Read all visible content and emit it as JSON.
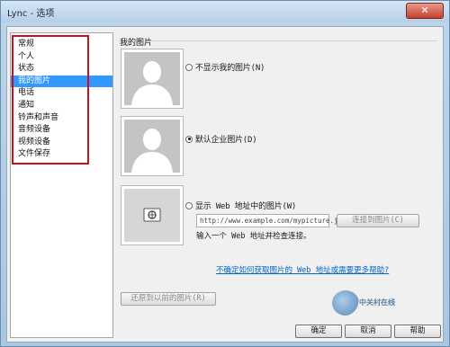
{
  "window": {
    "title": "Lync - 选项",
    "close_glyph": "✕"
  },
  "nav": {
    "items": [
      {
        "label": "常规",
        "selected": false
      },
      {
        "label": "个人",
        "selected": false
      },
      {
        "label": "状态",
        "selected": false
      },
      {
        "label": "我的图片",
        "selected": true
      },
      {
        "label": "电话",
        "selected": false
      },
      {
        "label": "通知",
        "selected": false
      },
      {
        "label": "铃声和声音",
        "selected": false
      },
      {
        "label": "音频设备",
        "selected": false
      },
      {
        "label": "视频设备",
        "selected": false
      },
      {
        "label": "文件保存",
        "selected": false
      }
    ],
    "highlight_color": "#c8101c"
  },
  "section": {
    "title": "我的图片"
  },
  "options": {
    "hide": {
      "label": "不显示我的图片(N)",
      "checked": false
    },
    "default": {
      "label": "默认企业图片(D)",
      "checked": true
    },
    "web": {
      "label": "显示 Web 地址中的图片(W)",
      "checked": false
    }
  },
  "url": {
    "placeholder": "http://www.example.com/mypicture.jpg",
    "connect_label": "连接到图片(C)",
    "hint": "输入一个 Web 地址并检查连接。"
  },
  "help_link": "不确定如何获取图片的 Web 地址或需要更多帮助?",
  "restore_label": "还原到以前的图片(R)",
  "footer": {
    "ok": "确定",
    "cancel": "取消",
    "help": "帮助"
  },
  "watermark": {
    "text": "中关村在线"
  },
  "colors": {
    "selection": "#3399ff",
    "link": "#0066cc"
  }
}
